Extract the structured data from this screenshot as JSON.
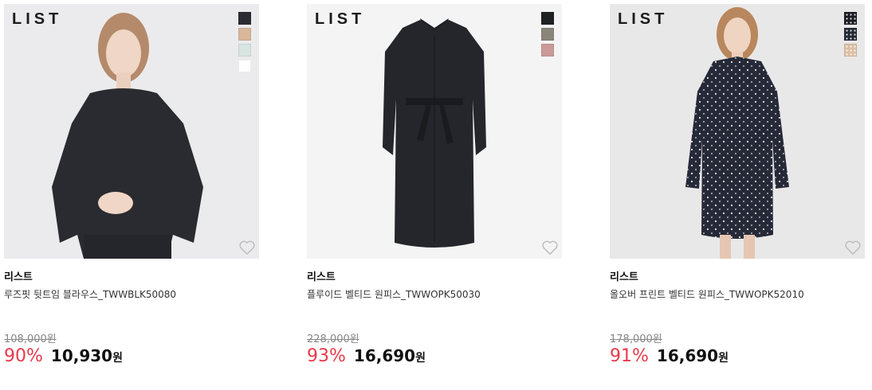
{
  "products": [
    {
      "brand_logo": "LIST",
      "brand": "리스트",
      "name": "루즈핏 뒷트임 블라우스_TWWBLK50080",
      "original_price": "108,000원",
      "discount": "90%",
      "sale_price": "10,930",
      "currency": "원",
      "swatches": [
        "#2b2c33",
        "#d8b79b",
        "#d7e4df",
        "#ffffff"
      ],
      "wishlist_icon": "heart-outline-icon"
    },
    {
      "brand_logo": "LIST",
      "brand": "리스트",
      "name": "플루이드 벨티드 원피스_TWWOPK50030",
      "original_price": "228,000원",
      "discount": "93%",
      "sale_price": "16,690",
      "currency": "원",
      "swatches": [
        "#1f2223",
        "#8a8579",
        "#c99a97"
      ],
      "wishlist_icon": "heart-outline-icon"
    },
    {
      "brand_logo": "LIST",
      "brand": "리스트",
      "name": "올오버 프린트 벨티드 원피스_TWWOPK52010",
      "original_price": "178,000원",
      "discount": "91%",
      "sale_price": "16,690",
      "currency": "원",
      "swatches": [
        "#1c1d24",
        "#232a36",
        "#dcbfa5"
      ],
      "wishlist_icon": "heart-outline-icon"
    }
  ]
}
